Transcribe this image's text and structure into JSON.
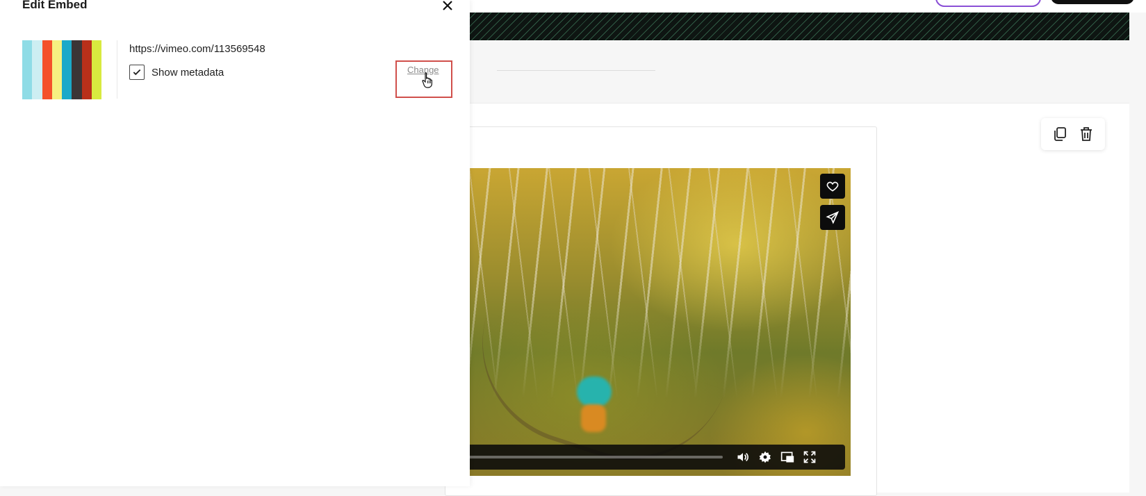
{
  "panel": {
    "title": "Edit Embed",
    "close_icon": "close-icon",
    "embed_url": "https://vimeo.com/113569548",
    "show_metadata_label": "Show metadata",
    "show_metadata_checked": true,
    "change_label": "Change"
  },
  "thumbnail": {
    "stripe_colors": [
      "#8fdce6",
      "#cdeef2",
      "#f4512a",
      "#f6f181",
      "#1ba9c9",
      "#3b3536",
      "#b9301a",
      "#d8ea3f"
    ]
  },
  "block_tools": {
    "duplicate_icon": "copy-icon",
    "delete_icon": "trash-icon"
  },
  "video": {
    "side_buttons": [
      "heart-icon",
      "send-icon"
    ],
    "control_icons": [
      "volume-icon",
      "settings-icon",
      "pip-icon",
      "fullscreen-icon"
    ]
  },
  "colors": {
    "highlight": "#d04f4b",
    "link": "#8a8a8a",
    "accent_outline": "#8a4fd6"
  }
}
